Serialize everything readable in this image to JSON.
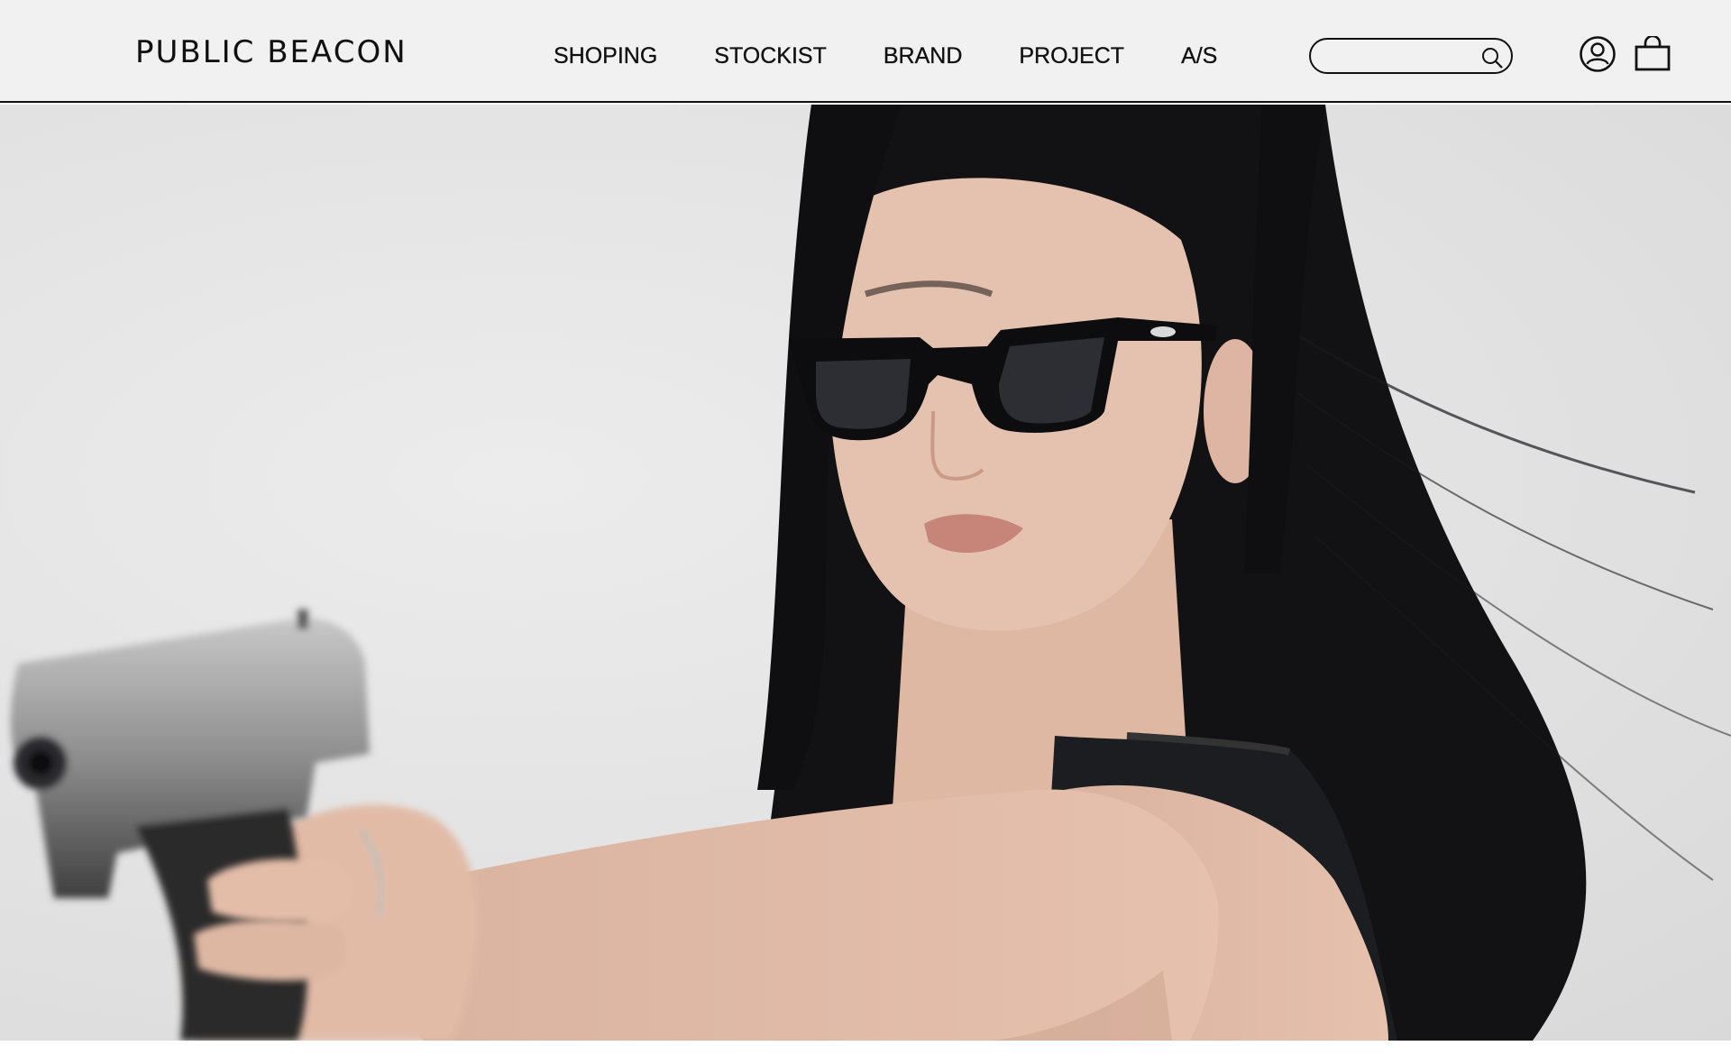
{
  "header": {
    "logo": "PUBLIC BEACON",
    "nav": [
      {
        "label": "SHOPING"
      },
      {
        "label": "STOCKIST"
      },
      {
        "label": "BRAND"
      },
      {
        "label": "PROJECT"
      },
      {
        "label": "A/S"
      }
    ],
    "search": {
      "value": "",
      "placeholder": "",
      "icon": "search-icon"
    },
    "icons": {
      "account": "account-icon",
      "bag": "shopping-bag-icon"
    }
  },
  "colors": {
    "header_bg": "#f1f1f1",
    "text": "#111111",
    "hero_bg": "#e3e3e3"
  }
}
